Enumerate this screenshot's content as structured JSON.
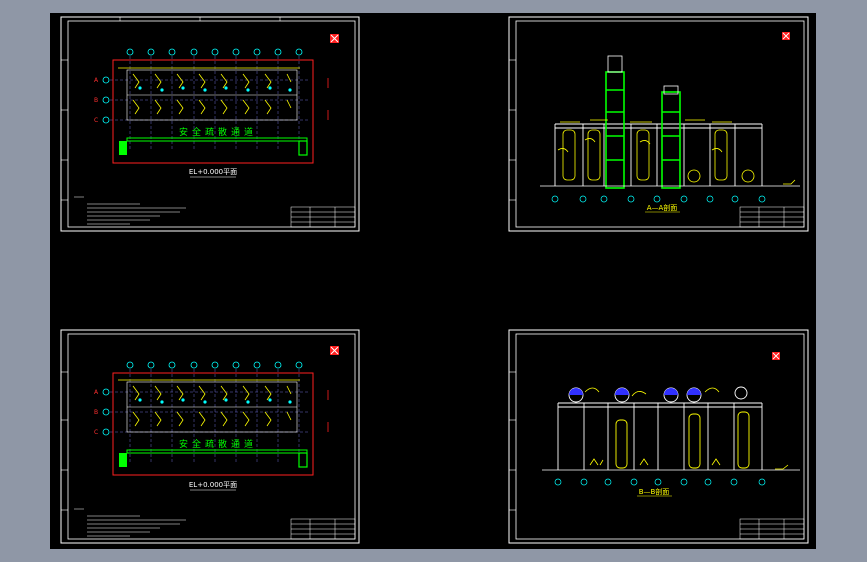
{
  "app": {
    "viewer": "CAD drawing preview",
    "background_color": "#8f97a6",
    "canvas_color": "#000000",
    "frame_color": "#ffffff",
    "highlight_colors": {
      "outline_red": "#ff2020",
      "piping_yellow": "#ffff00",
      "equipment_green": "#00ff00",
      "gridline_cyan": "#00ffff"
    }
  },
  "sheets": {
    "plan_top": {
      "title": "EL+0.000平面",
      "band_label": "安全疏散通道",
      "row_labels": [
        "A",
        "B",
        "C"
      ]
    },
    "elev_top": {
      "title": "A—A剖面"
    },
    "plan_bottom": {
      "title": "EL+0.000平面",
      "band_label": "安全疏散通道",
      "row_labels": [
        "A",
        "B",
        "C"
      ]
    },
    "elev_bottom": {
      "title": "B—B剖面"
    }
  }
}
